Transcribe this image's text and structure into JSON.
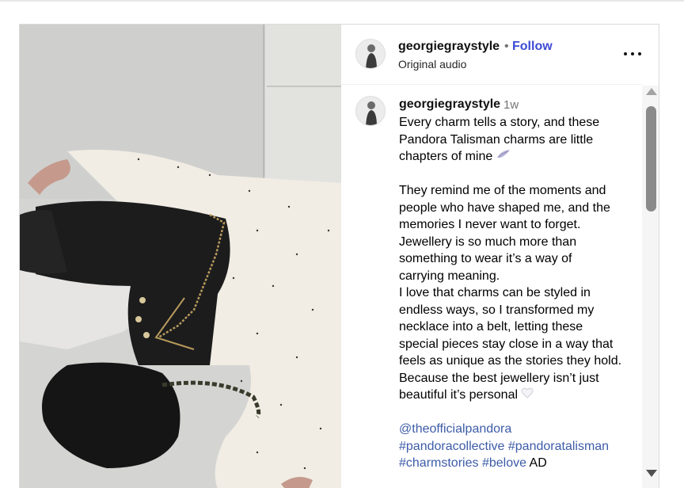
{
  "post": {
    "username": "georgiegraystyle",
    "separator": "•",
    "follow_label": "Follow",
    "audio_label": "Original audio",
    "more_icon": "more-horizontal-icon",
    "media_alt": "Outfit photo"
  },
  "comment": {
    "username": "georgiegraystyle",
    "time": "1w",
    "lines": [
      "Every charm tells a story, and these",
      "Pandora Talisman charms are little",
      "chapters of mine",
      "",
      "They remind me of the moments and",
      "people who have shaped me, and the",
      "memories I never want to forget.",
      "Jewellery is so much more than",
      "something to wear it’s a way of",
      "carrying meaning.",
      "I love that charms can be styled in",
      "endless ways, so I transformed my",
      "necklace into a belt, letting these",
      "special pieces stay close in a way that",
      "feels as unique as the stories they hold.",
      "Because the best jewellery isn’t just",
      "beautiful it’s personal",
      ""
    ],
    "mention": "@theofficialpandora",
    "hashtags_line1": [
      "#pandoracollective",
      "#pandoratalisman"
    ],
    "hashtags_line2": [
      "#charmstories",
      "#belove"
    ],
    "ad_label": "AD",
    "emoji_1": "wing-emoji",
    "emoji_2": "white-heart-emoji"
  },
  "colors": {
    "follow": "#3d4bd4",
    "link": "#3d5ca8",
    "muted": "#737373"
  }
}
